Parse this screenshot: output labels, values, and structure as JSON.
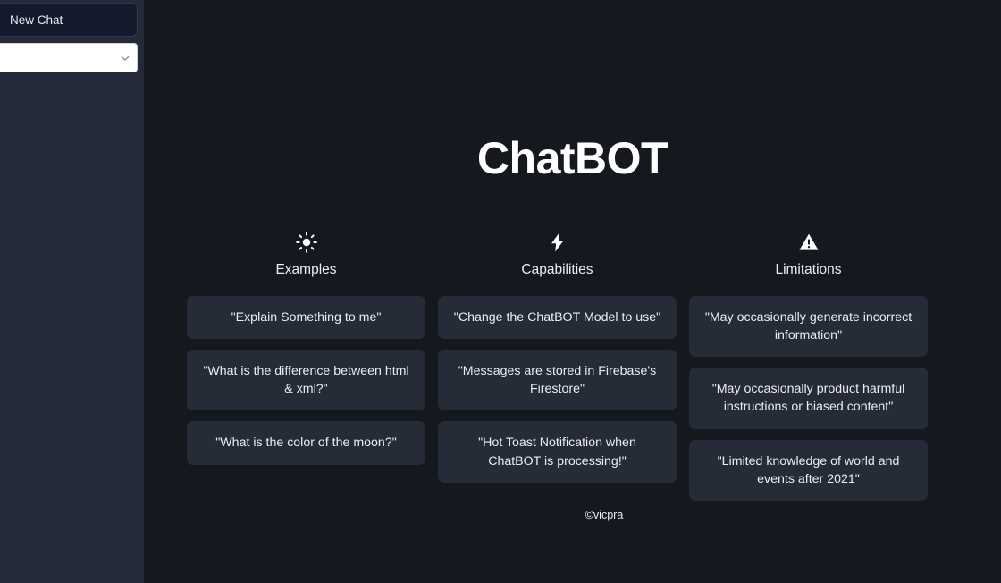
{
  "sidebar": {
    "new_chat_label": "New Chat",
    "model_select": {
      "selected_value": "",
      "icon": "chevron-down-icon"
    }
  },
  "main": {
    "title": "ChatBOT",
    "footer_credit": "©vicpra",
    "columns": [
      {
        "key": "examples",
        "icon": "sun-icon",
        "title": "Examples",
        "cards": [
          "\"Explain Something to me\"",
          "\"What is the difference between html & xml?\"",
          "\"What is the color of the moon?\""
        ]
      },
      {
        "key": "capabilities",
        "icon": "lightning-bolt-icon",
        "title": "Capabilities",
        "cards": [
          "\"Change the ChatBOT Model to use\"",
          "\"Messages are stored in Firebase's Firestore\"",
          "\"Hot Toast Notification when ChatBOT is processing!\""
        ]
      },
      {
        "key": "limitations",
        "icon": "warning-triangle-icon",
        "title": "Limitations",
        "cards": [
          "\"May occasionally generate incorrect information\"",
          "\"May occasionally product harmful instructions or biased content\"",
          "\"Limited knowledge of world and events after 2021\""
        ]
      }
    ]
  },
  "colors": {
    "main_background": "#16181f",
    "sidebar_background": "#252a38",
    "card_background": "#262b38",
    "new_chat_background": "#141a2b",
    "text_primary": "#ececf1",
    "select_background": "#ffffff"
  }
}
